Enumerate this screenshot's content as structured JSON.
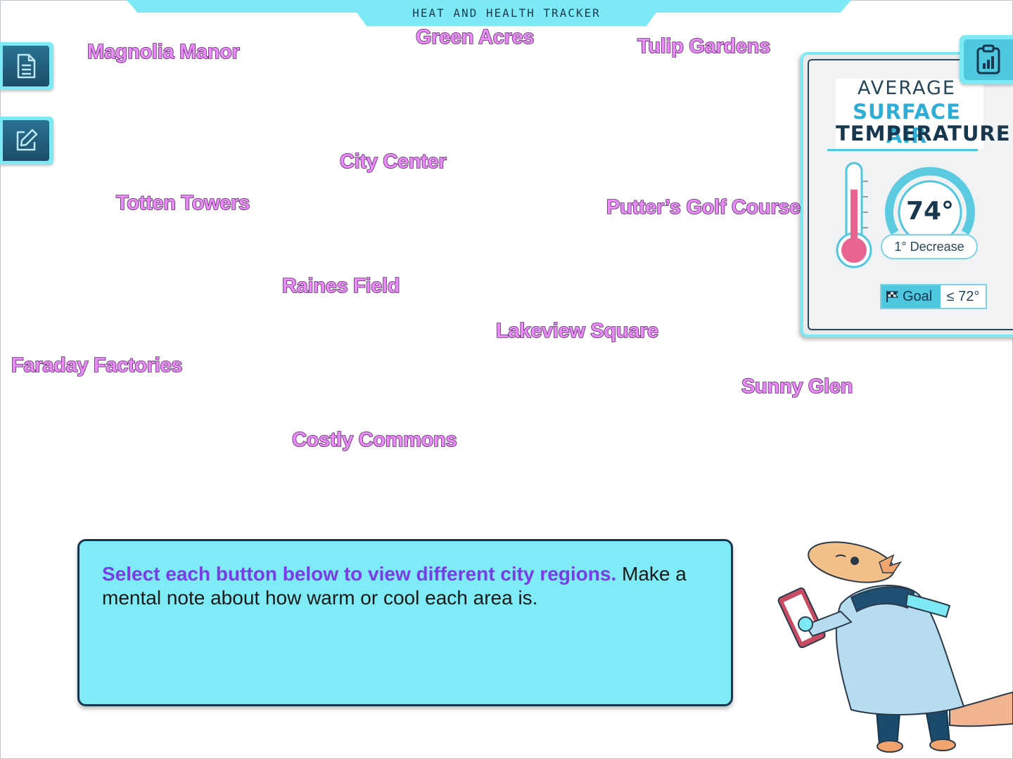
{
  "header": {
    "title": "HEAT AND HEALTH TRACKER"
  },
  "side_tools": [
    {
      "name": "notes",
      "icon": "document-icon"
    },
    {
      "name": "edit",
      "icon": "pencil-edit-icon"
    }
  ],
  "regions": [
    "Magnolia Manor",
    "Green Acres",
    "Tulip Gardens",
    "City Center",
    "Totten Towers",
    "Putter’s Golf Course",
    "Raines Field",
    "Lakeview Square",
    "Faraday Factories",
    "Sunny Glen",
    "Costly Commons"
  ],
  "temperature_panel": {
    "button_icon": "clipboard-chart-icon",
    "title_line1": "AVERAGE",
    "title_line2": "SURFACE AIR",
    "title_line3": "TEMPERATURE",
    "value": "74°",
    "change": "1° Decrease",
    "goal_label": "Goal",
    "goal_value": "≤ 72°",
    "thermometer_level": 0.72
  },
  "instructions": {
    "highlight": "Select each button below to view different city regions.",
    "text": " Make a mental note about how warm or cool each area is."
  },
  "colors": {
    "accent": "#7de9f5",
    "region_label": "#e98cf7",
    "highlight_text": "#7a3ce8",
    "dark": "#17374e"
  }
}
